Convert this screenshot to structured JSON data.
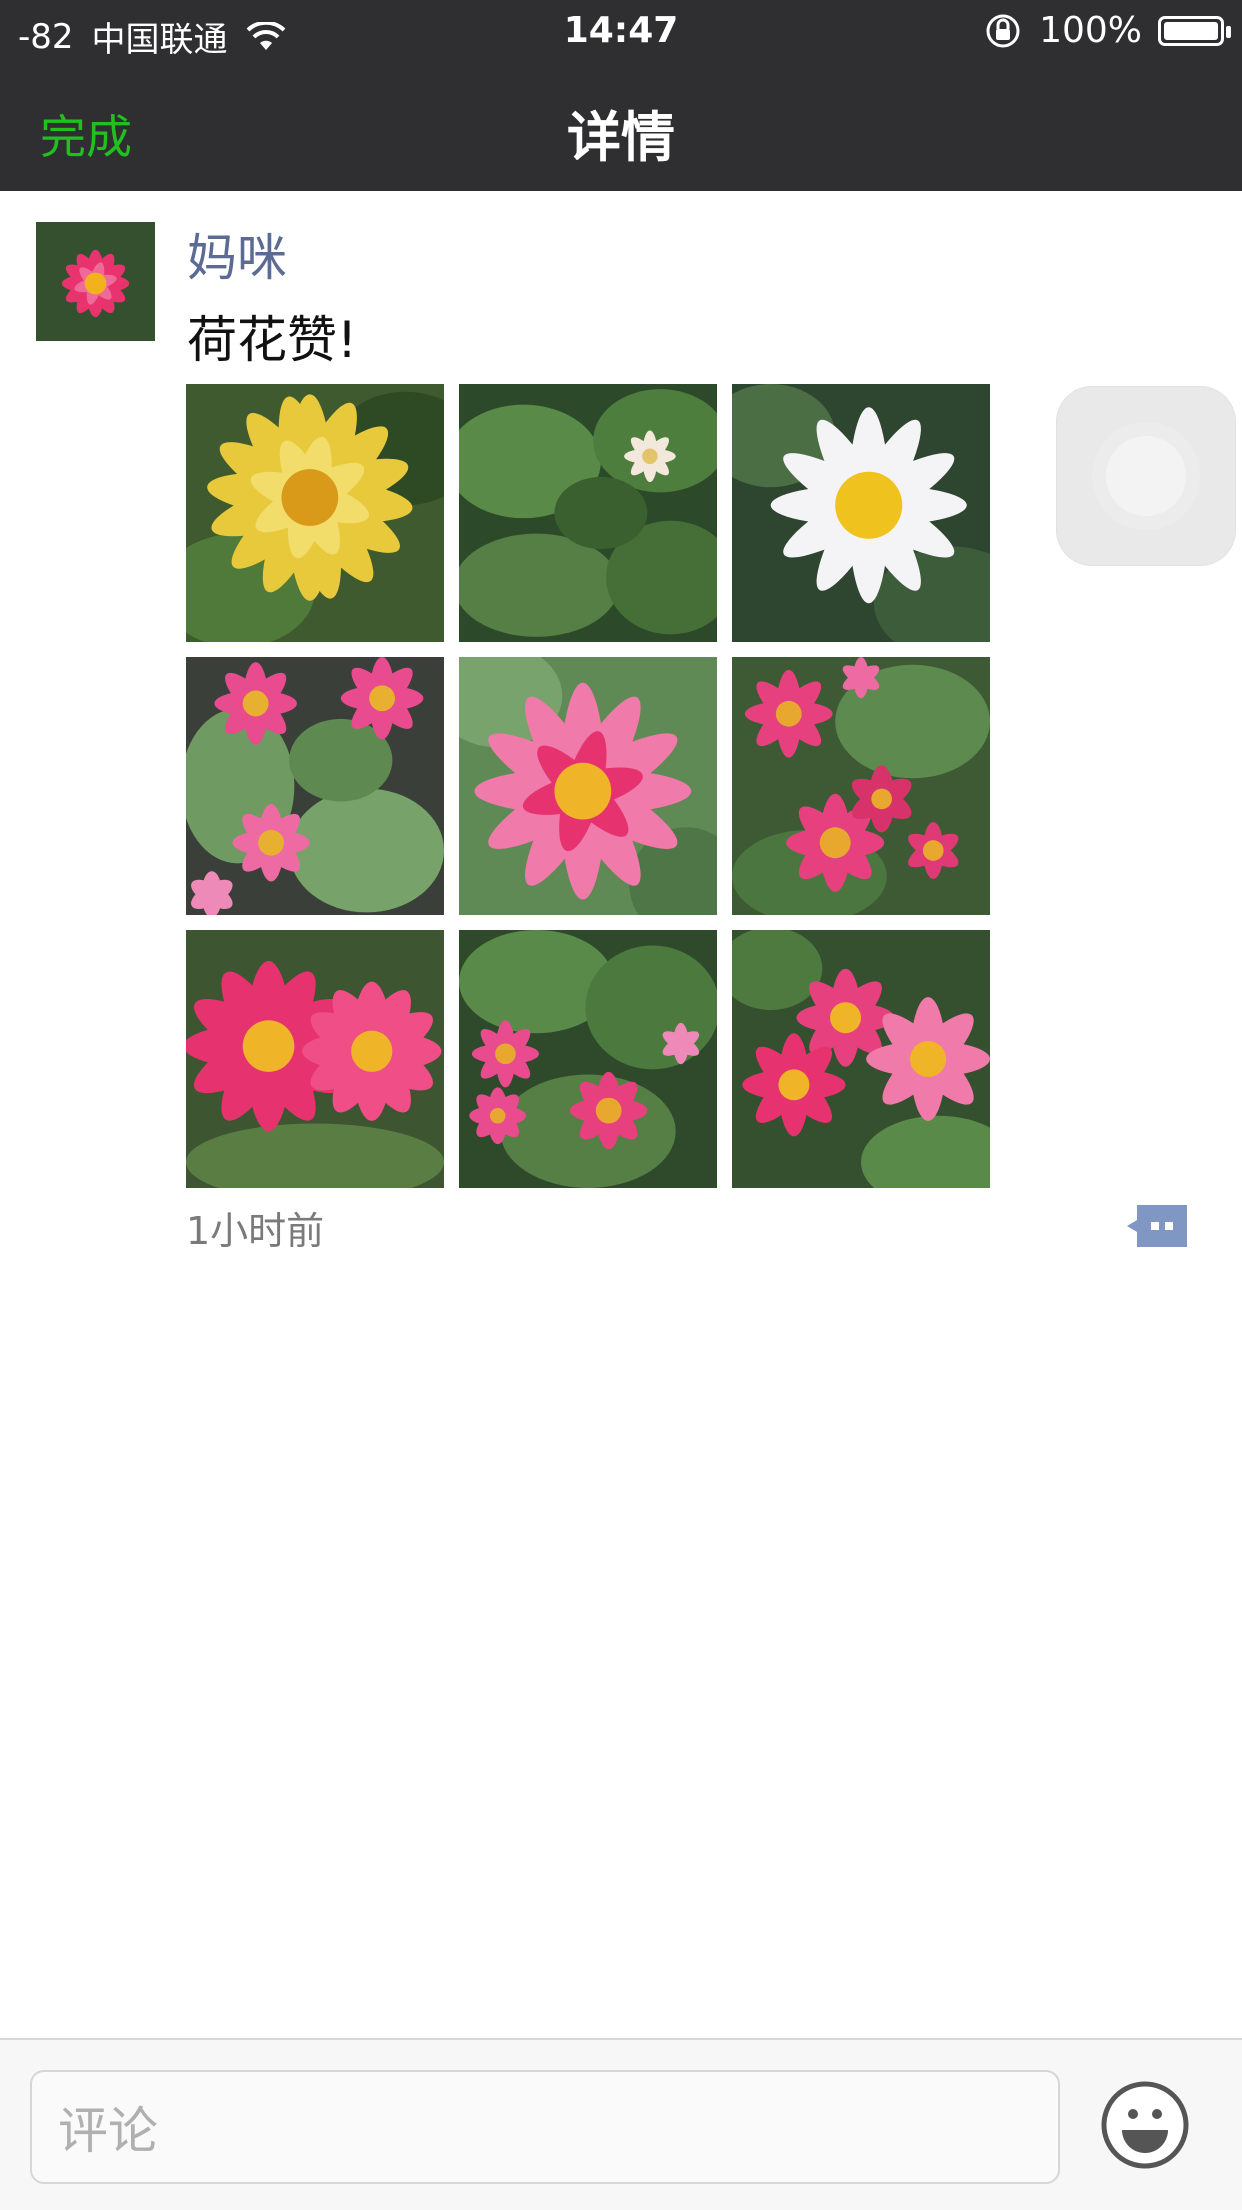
{
  "status_bar": {
    "signal": "-82",
    "carrier": "中国联通",
    "time": "14:47",
    "battery": "100%"
  },
  "nav": {
    "done_label": "完成",
    "title": "详情"
  },
  "post": {
    "username": "妈咪",
    "text": "荷花赞!",
    "timestamp": "1小时前",
    "photos": [
      "yellow-water-lily",
      "white-lily-bud-leaves",
      "white-water-lily",
      "pink-lilies-group",
      "pink-water-lily",
      "pink-lilies-cluster",
      "two-pink-lilies",
      "small-pink-lilies",
      "pink-lilies-trio"
    ]
  },
  "comment_bar": {
    "placeholder": "评论"
  },
  "colors": {
    "bar_bg": "#2f2f31",
    "accent_green": "#20c020",
    "name_blue": "#5b6b93"
  }
}
